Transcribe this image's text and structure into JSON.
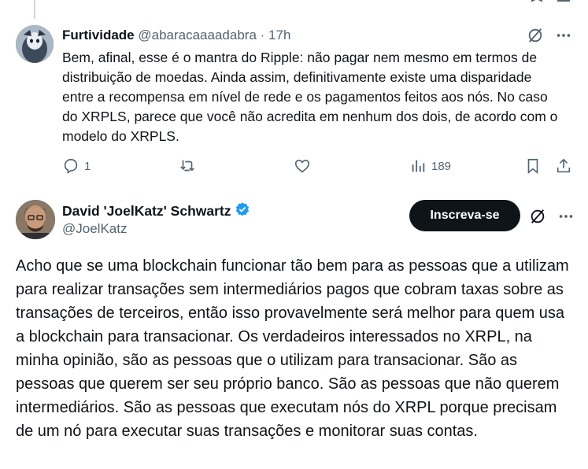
{
  "reply": {
    "author_name": "Furtividade",
    "author_handle": "@abaracaaaadabra",
    "separator": "·",
    "time": "17h",
    "body": "Bem, afinal, esse é o mantra do Ripple: não pagar nem mesmo em termos de distribuição de moedas. Ainda assim, definitivamente existe uma disparidade entre a recompensa em nível de rede e os pagamentos feitos aos nós. No caso do XRPLS, parece que você não acredita em nenhum dos dois, de acordo com o modelo do XRPLS.",
    "actions": {
      "replies": "1",
      "retweets": "",
      "likes": "",
      "views": "189"
    }
  },
  "main": {
    "author_name": "David 'JoelKatz' Schwartz",
    "author_handle": "@JoelKatz",
    "subscribe_label": "Inscreva-se",
    "body": "Acho que se uma blockchain funcionar tão bem para as pessoas que a utilizam para realizar transações sem intermediários pagos que cobram taxas sobre as transações de terceiros, então isso provavelmente será melhor para quem usa a blockchain para transacionar. Os verdadeiros interessados no XRPL, na minha opinião, são as pessoas que o utilizam para transacionar. São as pessoas que querem ser seu próprio banco. São as pessoas que não querem intermediários. São as pessoas que executam nós do XRPL porque precisam de um nó para executar suas transações e monitorar suas contas."
  },
  "icons": {
    "grok": "grok-icon",
    "more": "more-icon",
    "reply": "reply-icon",
    "retweet": "retweet-icon",
    "like": "like-icon",
    "views": "views-icon",
    "bookmark": "bookmark-icon",
    "share": "share-icon",
    "verified": "verified-badge-icon"
  },
  "colors": {
    "text": "#0f1419",
    "muted": "#536471",
    "verified": "#1d9bf0",
    "button_bg": "#0f1419"
  }
}
